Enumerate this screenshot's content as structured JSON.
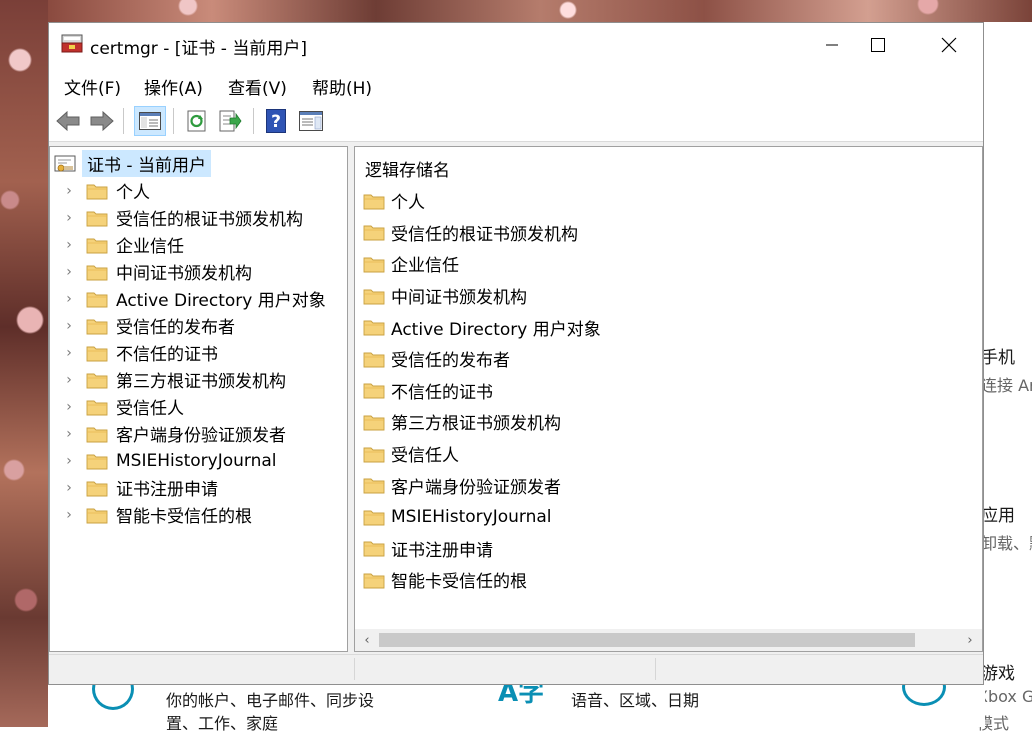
{
  "window": {
    "title": "certmgr - [证书 - 当前用户]",
    "icon": "certmgr-app-icon",
    "controls": {
      "minimize": "minimize-icon",
      "maximize": "maximize-icon",
      "close": "close-icon"
    }
  },
  "menu": [
    "文件(F)",
    "操作(A)",
    "查看(V)",
    "帮助(H)"
  ],
  "toolbar": [
    "back-arrow-icon",
    "forward-arrow-icon",
    "show-hide-tree-icon",
    "refresh-icon",
    "export-list-icon",
    "help-icon",
    "action-pane-icon"
  ],
  "tree": {
    "root": "证书 - 当前用户",
    "items": [
      "个人",
      "受信任的根证书颁发机构",
      "企业信任",
      "中间证书颁发机构",
      "Active Directory 用户对象",
      "受信任的发布者",
      "不信任的证书",
      "第三方根证书颁发机构",
      "受信任人",
      "客户端身份验证颁发者",
      "MSIEHistoryJournal",
      "证书注册申请",
      "智能卡受信任的根"
    ]
  },
  "list": {
    "header": "逻辑存储名",
    "items": [
      "个人",
      "受信任的根证书颁发机构",
      "企业信任",
      "中间证书颁发机构",
      "Active Directory 用户对象",
      "受信任的发布者",
      "不信任的证书",
      "第三方根证书颁发机构",
      "受信任人",
      "客户端身份验证颁发者",
      "MSIEHistoryJournal",
      "证书注册申请",
      "智能卡受信任的根"
    ]
  },
  "background_settings": {
    "right": [
      {
        "title": "手机",
        "sub": "连接 Ar"
      },
      {
        "title": "应用",
        "sub": "卸载、默"
      },
      {
        "title": "游戏",
        "sub": "Xbox G",
        "sub2": "模式"
      }
    ],
    "bottom": [
      {
        "line1": "你的帐户、电子邮件、同步设",
        "line2": "置、工作、家庭"
      },
      {
        "glyph": "A字",
        "line1": "语音、区域、日期"
      }
    ]
  },
  "colors": {
    "selection": "#cce8ff",
    "folder": "#f5d27a",
    "accent": "#0a8fb4"
  }
}
